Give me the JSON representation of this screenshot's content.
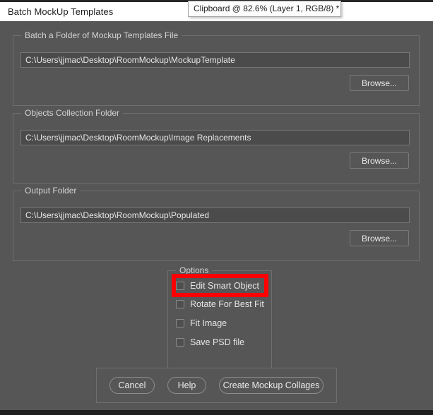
{
  "window": {
    "title": "Batch MockUp Templates"
  },
  "tooltip": {
    "text": "Clipboard @ 82.6% (Layer 1, RGB/8) *"
  },
  "groups": {
    "templates": {
      "title": "Batch a Folder of Mockup Templates File",
      "path_value": "C:\\Users\\jjmac\\Desktop\\RoomMockup\\MockupTemplate",
      "browse_label": "Browse..."
    },
    "objects": {
      "title": "Objects Collection Folder",
      "path_value": "C:\\Users\\jjmac\\Desktop\\RoomMockup\\Image Replacements",
      "browse_label": "Browse..."
    },
    "output": {
      "title": "Output Folder",
      "path_value": "C:\\Users\\jjmac\\Desktop\\RoomMockup\\Populated",
      "browse_label": "Browse..."
    },
    "options": {
      "title": "Options",
      "items": [
        {
          "label": "Edit Smart Object",
          "checked": false
        },
        {
          "label": "Rotate For Best Fit",
          "checked": false
        },
        {
          "label": "Fit Image",
          "checked": false
        },
        {
          "label": "Save PSD file",
          "checked": false
        }
      ]
    }
  },
  "actions": {
    "cancel_label": "Cancel",
    "help_label": "Help",
    "create_label": "Create Mockup Collages"
  },
  "annotation": {
    "highlight_color": "#fe0000",
    "target": "Edit Smart Object"
  },
  "colors": {
    "dialog_bg": "#565656",
    "field_bg": "#4b4b4b",
    "titlebar_bg": "#ffffff",
    "text": "#e6e6e6"
  }
}
